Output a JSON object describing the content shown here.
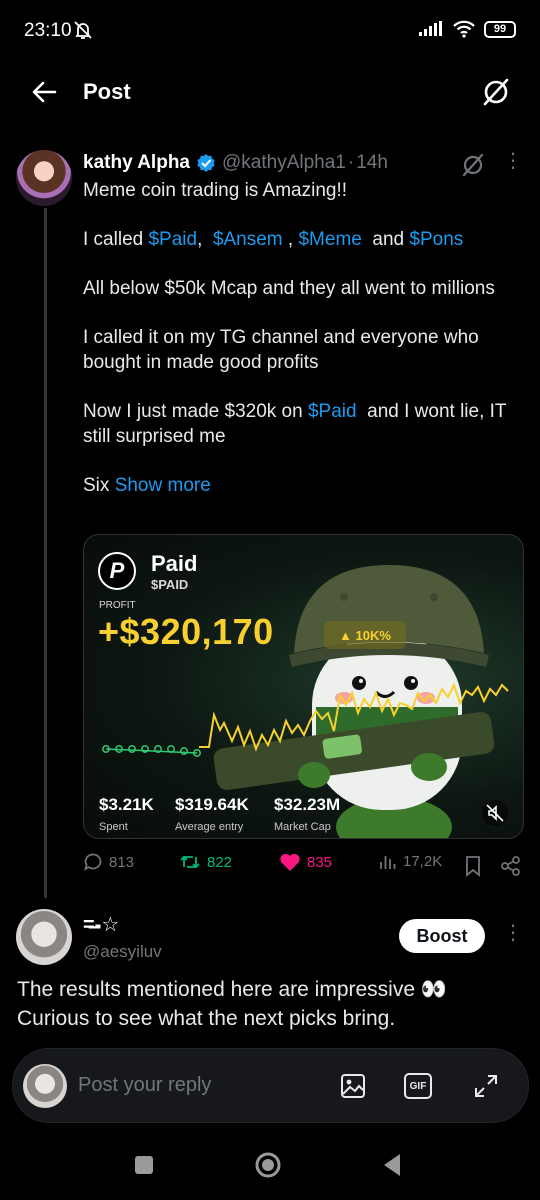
{
  "status_bar": {
    "time": "23:10",
    "battery": "99",
    "icons": [
      "mute-bell-icon",
      "signal-icon",
      "wifi-icon",
      "battery-icon"
    ]
  },
  "header": {
    "title": "Post",
    "icons": [
      "back-arrow-icon",
      "grok-icon"
    ]
  },
  "post": {
    "author_name": "kathy Alpha",
    "handle": "@kathyAlpha1",
    "separator": "·",
    "time": "14h",
    "body": {
      "line1": "Meme coin trading is Amazing!!",
      "called_prefix": "I called",
      "tag1": "$Paid",
      "sep1": ",",
      "tag2": "$Ansem",
      "sep2": ",",
      "tag3": "$Meme",
      "and": "and",
      "tag4": "$Pons",
      "para3": "All below $50k Mcap and they all went to millions",
      "para4": "I called it on my TG channel and everyone who bought in made good profits",
      "para5_prefix": "Now I just made $320k  on",
      "para5_tag": "$Paid",
      "para5_suffix": "and I wont lie, IT still surprised me",
      "para6_prefix": "Six",
      "show_more": "Show more"
    },
    "media": {
      "token_name": "Paid",
      "ticker": "$PAID",
      "profit_label": "PROFIT",
      "profit_value": "+$320,170",
      "percent_badge": "▲ 10K%",
      "stats": [
        {
          "value": "$3.21K",
          "label": "Spent"
        },
        {
          "value": "$319.64K",
          "label": "Average entry"
        },
        {
          "value": "$32.23M",
          "label": "Market Cap"
        }
      ],
      "colors": {
        "accent": "#f7d02f",
        "up": "#2ecc71"
      }
    },
    "actions": {
      "replies": "813",
      "reposts": "822",
      "likes": "835",
      "views": "17,2K"
    },
    "colors": {
      "link": "#1d9bf0",
      "repost": "#00ba7c",
      "like": "#f91880",
      "muted": "#71767b"
    }
  },
  "reply": {
    "name": "=̶̶-☆",
    "handle": "@aesyiluv",
    "boost_label": "Boost",
    "text": "The results mentioned here are impressive 👀 Curious to see what the next picks bring."
  },
  "composer": {
    "placeholder": "Post your reply",
    "gif_label": "GIF",
    "icons": [
      "image-icon",
      "gif-icon",
      "expand-icon"
    ]
  },
  "navbar": {
    "icons": [
      "recents-square-icon",
      "home-circle-icon",
      "back-triangle-icon"
    ]
  }
}
